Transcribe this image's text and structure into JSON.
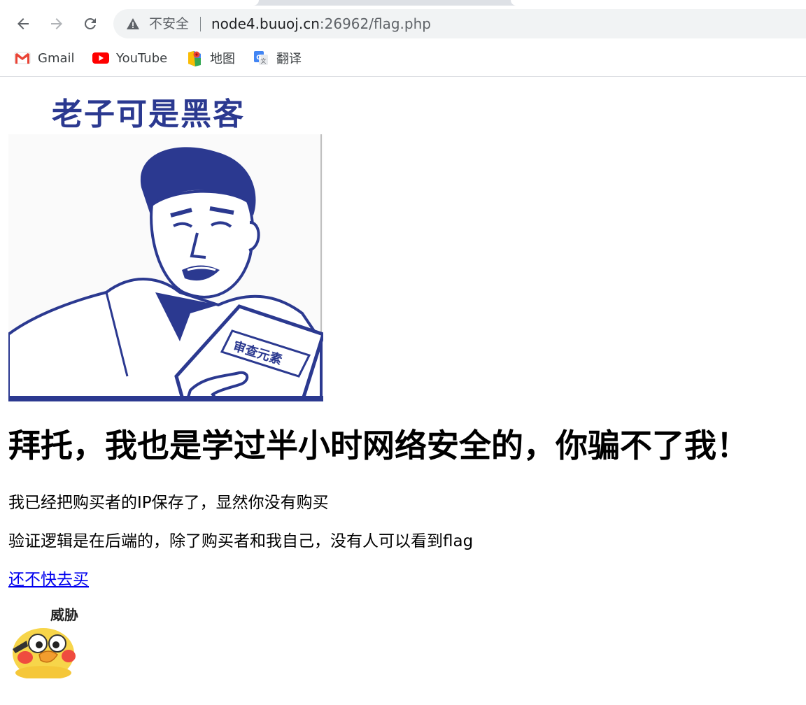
{
  "browser": {
    "address_bar": {
      "security_label": "不安全",
      "url_host": "node4.buuoj.cn",
      "url_rest": ":26962/flag.php"
    },
    "bookmarks": [
      {
        "label": "Gmail",
        "icon": "gmail-icon"
      },
      {
        "label": "YouTube",
        "icon": "youtube-icon"
      },
      {
        "label": "地图",
        "icon": "maps-icon"
      },
      {
        "label": "翻译",
        "icon": "translate-icon"
      }
    ]
  },
  "page": {
    "meme_image": {
      "caption": "老子可是黑客",
      "book_text": "审查元素",
      "icon": "hacker-meme-image"
    },
    "headline": "拜托，我也是学过半小时网络安全的，你骗不了我！",
    "paragraphs": [
      "我已经把购买者的IP保存了，显然你没有购买",
      "验证逻辑是在后端的，除了购买者和我自己，没有人可以看到flag"
    ],
    "buy_link": "还不快去买",
    "sticker_image": {
      "caption": "威胁",
      "icon": "threat-duck-sticker"
    }
  },
  "colors": {
    "link": "#0000ee",
    "meme_blue": "#2b3990",
    "omnibox_bg": "#f1f3f4"
  }
}
